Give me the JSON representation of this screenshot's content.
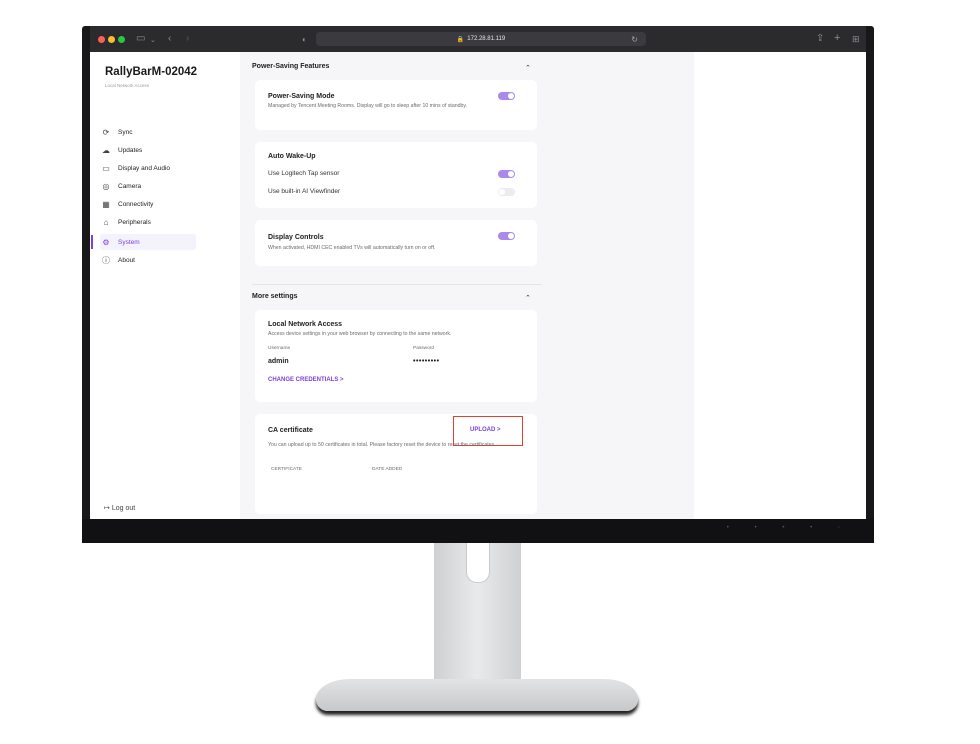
{
  "browser": {
    "url": "172.28.81.119",
    "traffic_lights": [
      "#ff5f57",
      "#febc2e",
      "#28c840"
    ]
  },
  "sidebar": {
    "device_name": "RallyBarM-02042",
    "subtitle": "Local Network Access",
    "items": [
      {
        "label": "Sync",
        "icon": "sync-icon",
        "glyph": "⟳"
      },
      {
        "label": "Updates",
        "icon": "cloud-icon",
        "glyph": "☁"
      },
      {
        "label": "Display and Audio",
        "icon": "display-icon",
        "glyph": "▭"
      },
      {
        "label": "Camera",
        "icon": "camera-icon",
        "glyph": "◎"
      },
      {
        "label": "Connectivity",
        "icon": "connectivity-icon",
        "glyph": "▦"
      },
      {
        "label": "Peripherals",
        "icon": "peripherals-icon",
        "glyph": "⌂"
      },
      {
        "label": "System",
        "icon": "system-icon",
        "glyph": "⚙"
      },
      {
        "label": "About",
        "icon": "info-icon",
        "glyph": "ⓘ"
      }
    ],
    "active_item": "System",
    "logout": "Log out",
    "accent": "#7b3fe4"
  },
  "power_saving": {
    "title": "Power-Saving Features",
    "mode": {
      "title": "Power-Saving Mode",
      "description": "Managed by Tencent Meeting Rooms. Display will go to sleep after 10 mins of standby.",
      "enabled": true
    },
    "wake": {
      "title": "Auto Wake-Up",
      "tap_sensor": "Use Logitech Tap sensor",
      "tap_enabled": true,
      "viewfinder": "Use built-in AI Viewfinder",
      "viewfinder_enabled": false
    },
    "display_controls": {
      "title": "Display Controls",
      "description": "When activated, HDMI CEC enabled TVs will automatically turn on or off.",
      "enabled": true
    }
  },
  "more_settings": {
    "title": "More settings",
    "local_access": {
      "title": "Local Network Access",
      "description": "Access device settings in your web browser by connecting to the same network.",
      "username_label": "Username",
      "username": "admin",
      "password_label": "Password",
      "password": "•••••••••",
      "change_link": "CHANGE CREDENTIALS  >"
    },
    "ca_certificate": {
      "title": "CA certificate",
      "upload": "UPLOAD  >",
      "description": "You can upload up to 50 certificates in total. Please factory reset the device to reset the certificates.",
      "col_certificate": "CERTIFICATE",
      "col_date": "DATE ADDED"
    }
  }
}
